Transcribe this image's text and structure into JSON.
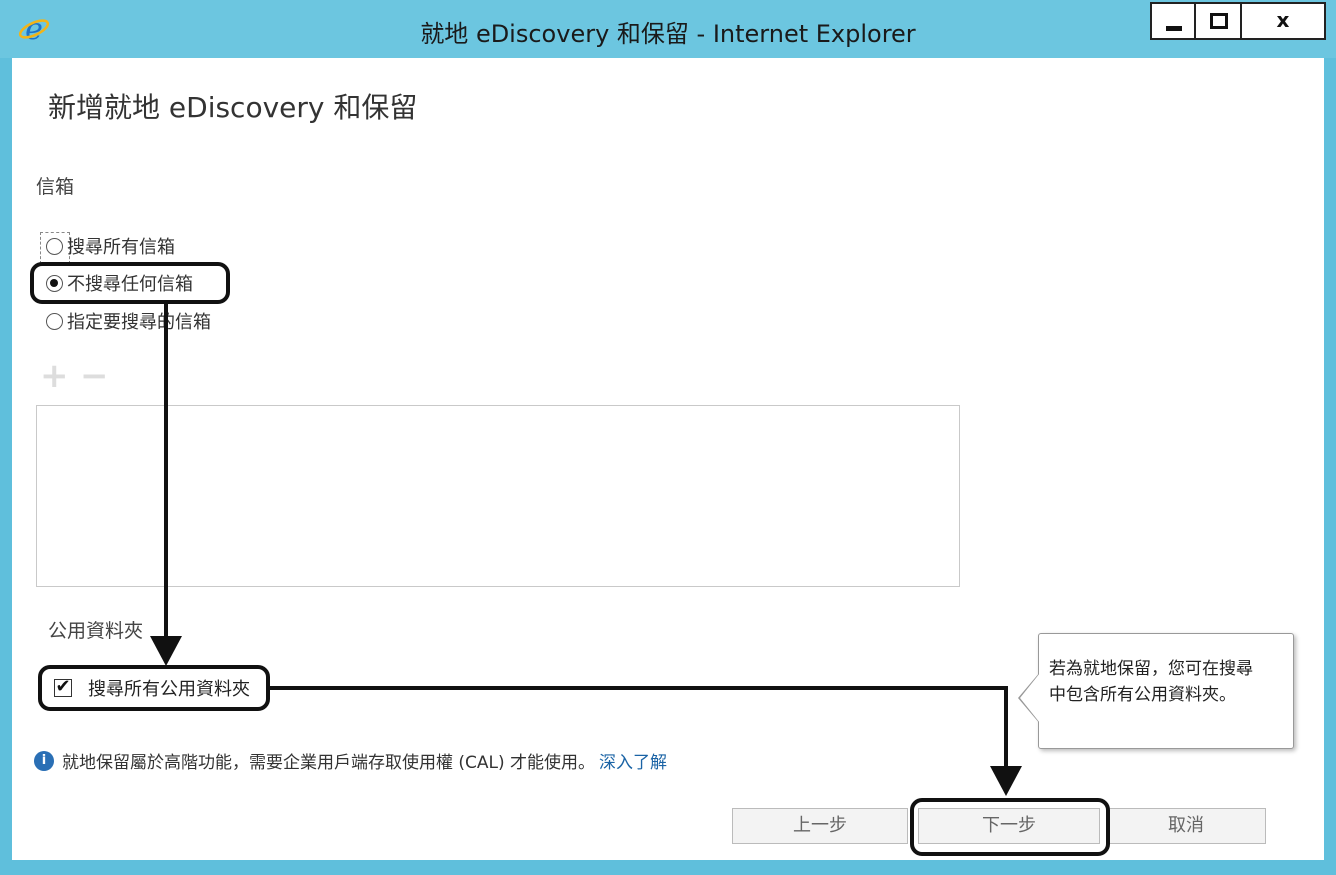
{
  "window": {
    "title": "就地 eDiscovery 和保留 - Internet Explorer",
    "close_label": "x"
  },
  "page": {
    "title": "新增就地 eDiscovery 和保留"
  },
  "mailboxes": {
    "section_label": "信箱",
    "options": [
      {
        "label": "搜尋所有信箱",
        "selected": false
      },
      {
        "label": "不搜尋任何信箱",
        "selected": true
      },
      {
        "label": "指定要搜尋的信箱",
        "selected": false
      }
    ],
    "add_symbol": "+",
    "remove_symbol": "−"
  },
  "public_folders": {
    "section_label": "公用資料夾",
    "checkbox_label": "搜尋所有公用資料夾",
    "checked": true,
    "check_mark": "✔"
  },
  "info": {
    "icon_glyph": "i",
    "text": "就地保留屬於高階功能，需要企業用戶端存取使用權 (CAL) 才能使用。",
    "link": "深入了解"
  },
  "tooltip": {
    "line1": "若為就地保留，您可在搜尋",
    "line2": "中包含所有公用資料夾。"
  },
  "buttons": {
    "back": "上一步",
    "next": "下一步",
    "cancel": "取消"
  },
  "colors": {
    "titlebar": "#6cc6e0",
    "link": "#1a63a5",
    "annotation": "#111111"
  }
}
